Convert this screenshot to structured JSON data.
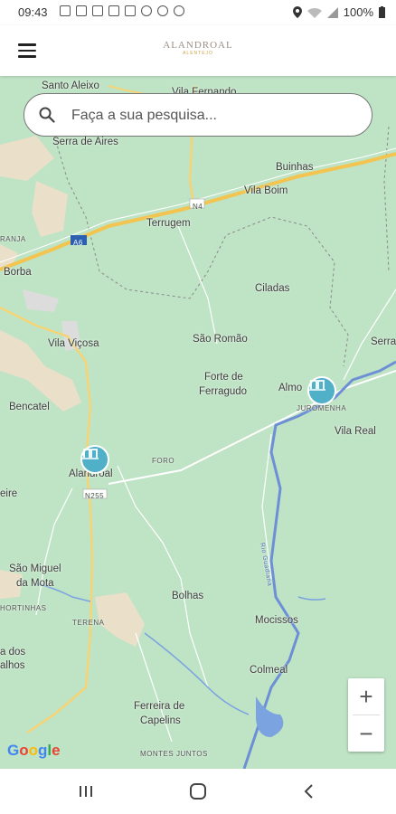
{
  "status_bar": {
    "time": "09:43",
    "battery": "100%",
    "left_icons": [
      "sim-icon",
      "sim-icon",
      "sim-icon",
      "mail-icon",
      "mail-icon",
      "cloud-icon",
      "minus-circle-icon",
      "cloud-icon"
    ],
    "right_icons": [
      "location-icon",
      "wifi-icon",
      "signal-icon",
      "battery-icon"
    ]
  },
  "app_bar": {
    "menu_icon": "hamburger-icon",
    "logo": "ALANDROAL",
    "logo_tagline": "ALENTEJO"
  },
  "search": {
    "placeholder": "Faça a sua pesquisa...",
    "icon": "search-icon"
  },
  "map": {
    "labels": {
      "santo_aleixo": "Santo Aleixo",
      "vila_fernando": "Vila Fernando",
      "serra_de_aires": "Serra de Aires",
      "bucinhas": "Buinhas",
      "vila_boim": "Vila Boim",
      "n4": "N4",
      "terrugem": "Terrugem",
      "a6": "A6",
      "granja": "RANJA",
      "borba": "Borba",
      "ciladas": "Ciladas",
      "vila_vicosa": "Vila Viçosa",
      "sao_romao": "São Romão",
      "serra": "Serra",
      "forte_de_ferragudo": "Forte de\nFerragudo",
      "almo": "Almo",
      "juromenha": "JUROMENHA",
      "bencatel": "Bencatel",
      "vila_real": "Vila Real",
      "foro": "FORO",
      "alandroal": "Alandroal",
      "eire": "eire",
      "n255": "N255",
      "guadiana": "Rio Guadiana",
      "sao_miguel_da_mota": "São Miguel\nda Mota",
      "bolhas": "Bolhas",
      "hortinhas": "HORTINHAS",
      "terena": "TERENA",
      "mocissos": "Mocissos",
      "dos_alhos": "a dos\nalhos",
      "colmeal": "Colmeal",
      "ferreira_de_capelins": "Ferreira de\nCapelins",
      "montes_juntos": "MONTES JUNTOS"
    },
    "markers": [
      "beach-marker-icon",
      "beach-marker-icon"
    ],
    "zoom_in": "+",
    "zoom_out": "−",
    "attribution": "Google"
  },
  "nav_bar": {
    "recent": "recent-apps-icon",
    "home": "home-icon",
    "back": "back-icon"
  }
}
